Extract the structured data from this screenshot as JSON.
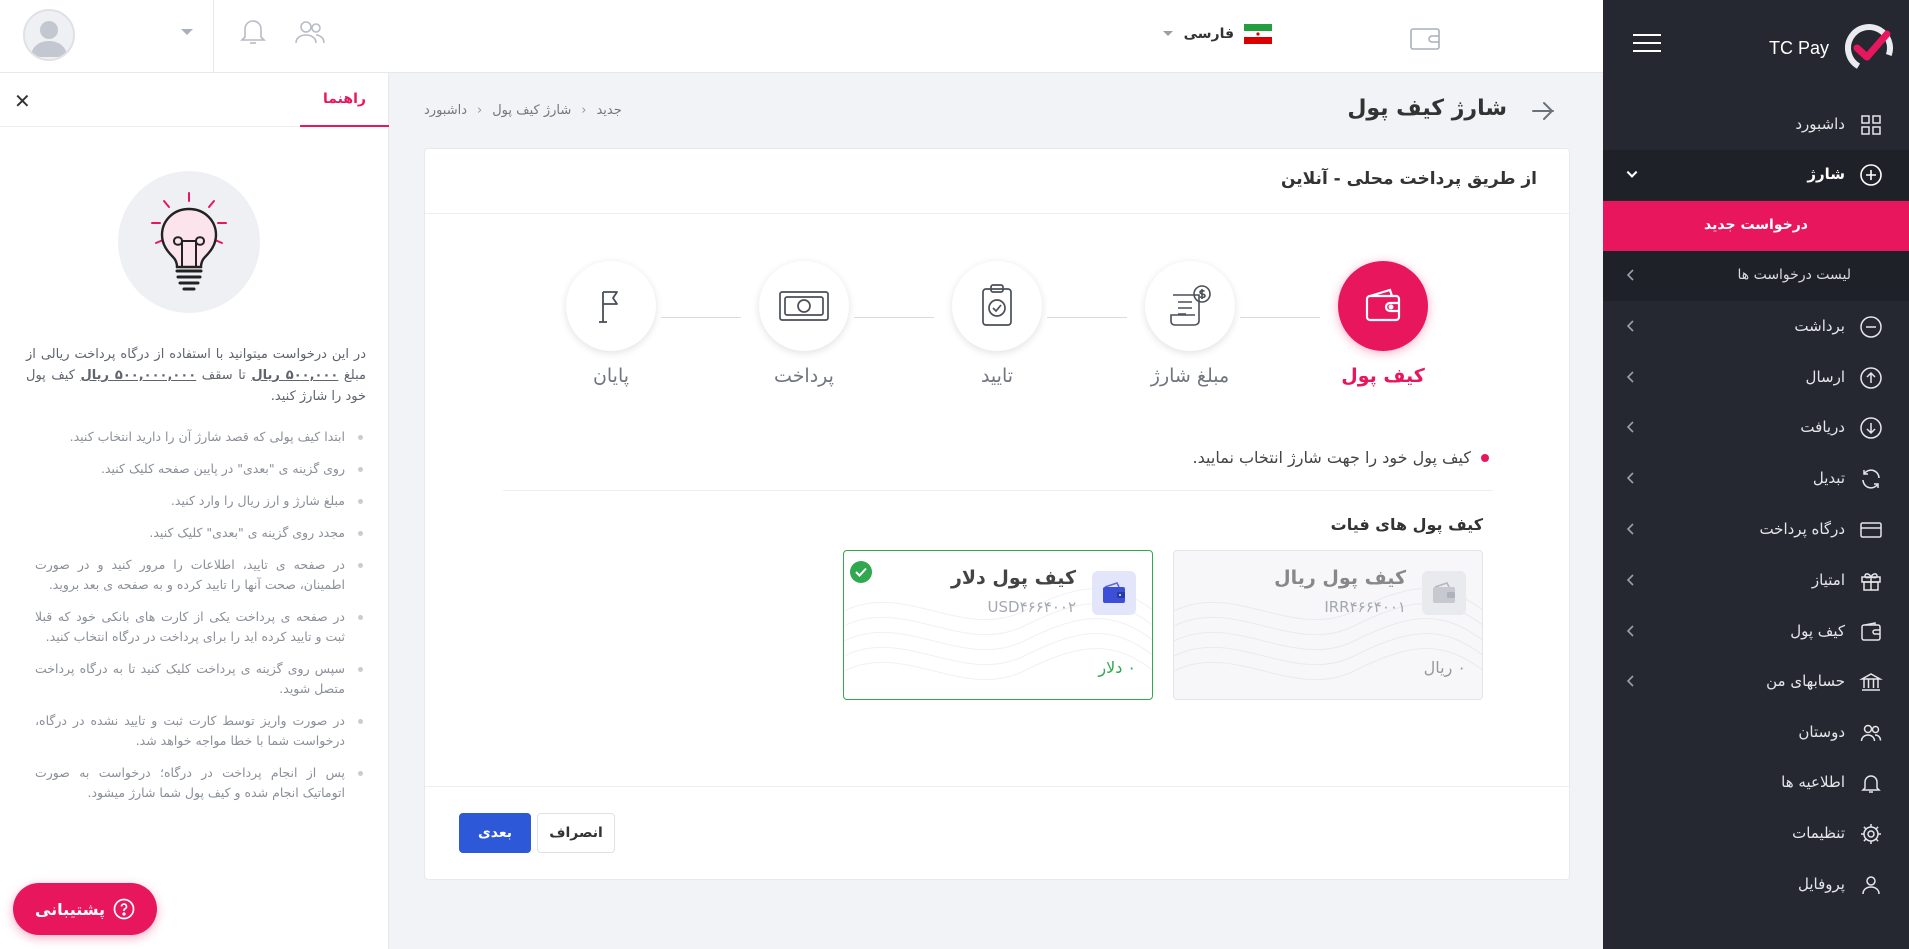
{
  "sidebar": {
    "brand": "TC Pay",
    "items": [
      {
        "label": "داشبورد",
        "icon": "dashboard-grid-icon"
      },
      {
        "label": "شارژ",
        "icon": "plus-circle-icon"
      },
      {
        "label": "برداشت",
        "icon": "minus-circle-icon"
      },
      {
        "label": "ارسال",
        "icon": "arrow-up-circle-icon"
      },
      {
        "label": "دریافت",
        "icon": "arrow-down-circle-icon"
      },
      {
        "label": "تبدیل",
        "icon": "refresh-icon"
      },
      {
        "label": "درگاه پرداخت",
        "icon": "card-icon"
      },
      {
        "label": "امتیاز",
        "icon": "gift-icon"
      },
      {
        "label": "کیف پول",
        "icon": "wallet-icon"
      },
      {
        "label": "حسابهای من",
        "icon": "bank-icon"
      },
      {
        "label": "دوستان",
        "icon": "users-icon"
      },
      {
        "label": "اطلاعیه ها",
        "icon": "bell-icon"
      },
      {
        "label": "تنظیمات",
        "icon": "gear-icon"
      },
      {
        "label": "پروفایل",
        "icon": "user-icon"
      }
    ],
    "sub_items": [
      {
        "label": "درخواست جدید",
        "active": true
      },
      {
        "label": "لیست درخواست ها",
        "active": false
      }
    ],
    "accent_color": "#e8175d"
  },
  "topbar": {
    "language": "فارسی"
  },
  "page": {
    "title": "شارژ کیف پول",
    "breadcrumb": [
      "داشبورد",
      "شارژ کیف پول",
      "جدید"
    ]
  },
  "card": {
    "header": "از طریق پرداخت محلی - آنلاین",
    "steps": [
      {
        "label": "کیف پول",
        "icon": "wallet-icon",
        "active": true
      },
      {
        "label": "مبلغ شارژ",
        "icon": "invoice-dollar-icon",
        "active": false
      },
      {
        "label": "تایید",
        "icon": "clipboard-check-icon",
        "active": false
      },
      {
        "label": "پرداخت",
        "icon": "cash-icon",
        "active": false
      },
      {
        "label": "پایان",
        "icon": "flag-icon",
        "active": false
      }
    ],
    "instruction": "کیف پول خود را جهت شارژ انتخاب نمایید.",
    "section_title": "کیف پول های فیات",
    "wallets": [
      {
        "name": "کیف پول ریال",
        "code": "IRR۴۶۶۴۰۰۱",
        "balance": "۰ ریال",
        "selected": false
      },
      {
        "name": "کیف پول دلار",
        "code": "USD۴۶۶۴۰۰۲",
        "balance": "۰ دلار",
        "selected": true
      }
    ],
    "next_label": "بعدی",
    "cancel_label": "انصراف"
  },
  "help": {
    "tab_label": "راهنما",
    "intro_parts": [
      "در این درخواست میتوانید با استفاده از درگاه پرداخت ریالی از مبلغ ",
      "۵۰۰,۰۰۰ ریال",
      " تا سقف ",
      "۵۰۰,۰۰۰,۰۰۰ ریال",
      " کیف پول خود را شارژ کنید."
    ],
    "bullets": [
      "ابتدا کیف پولی که قصد شارژ آن را دارید انتخاب کنید.",
      "روی گزینه ی \"بعدی\" در پایین صفحه کلیک کنید.",
      "مبلغ شارژ و ارز ریال را وارد کنید.",
      "مجدد روی گزینه ی \"بعدی\" کلیک کنید.",
      "در صفحه ی تایید، اطلاعات را مرور کنید و در صورت اطمینان، صحت آنها را تایید کرده و به صفحه ی بعد بروید.",
      "در صفحه ی پرداخت یکی از کارت های بانکی خود که قبلا ثبت و تایید کرده اید را برای پرداخت در درگاه انتخاب کنید.",
      "سپس روی گزینه ی پرداخت کلیک کنید تا به درگاه پرداخت متصل شوید.",
      "در صورت واریز توسط کارت ثبت و تایید نشده در درگاه، درخواست شما با خطا مواجه خواهد شد.",
      "پس از انجام پرداخت در درگاه؛ درخواست به صورت اتوماتیک انجام شده و کیف پول شما شارژ میشود."
    ],
    "support_label": "پشتیبانی"
  }
}
